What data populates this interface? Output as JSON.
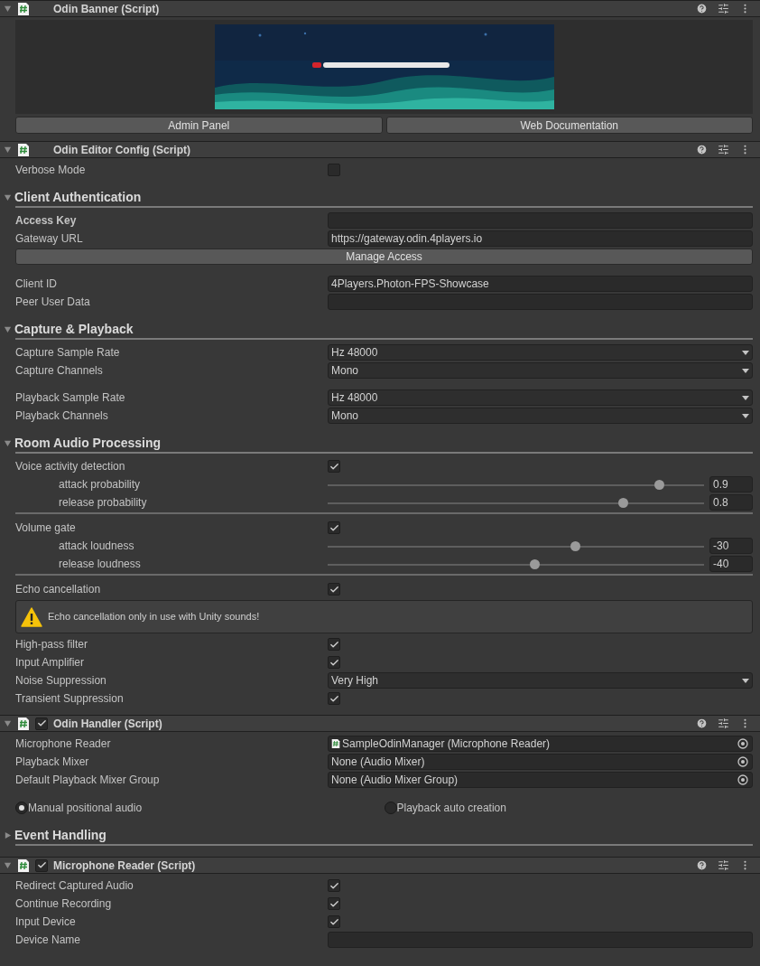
{
  "components": [
    {
      "title": "Odin Banner (Script)",
      "expanded": true,
      "rows": [
        {
          "kind": "banner"
        },
        {
          "kind": "buttons",
          "labels": [
            "Admin Panel",
            "Web Documentation"
          ]
        }
      ]
    },
    {
      "title": "Odin Editor Config (Script)",
      "expanded": true,
      "rows": [
        {
          "kind": "checkbox",
          "label": "Verbose Mode",
          "checked": false
        },
        {
          "kind": "section",
          "title": "Client Authentication",
          "expanded": true,
          "divided": false,
          "groups": [
            [
              {
                "kind": "text",
                "label": "Access Key",
                "bold": true
              },
              {
                "kind": "text",
                "label": "Gateway URL",
                "value": "https://gateway.odin.4players.io"
              },
              {
                "kind": "button",
                "label": "Manage Access"
              }
            ],
            [
              {
                "kind": "text",
                "label": "Client ID",
                "value": "4Players.Photon-FPS-Showcase"
              },
              {
                "kind": "text",
                "label": "Peer User Data"
              }
            ]
          ]
        },
        {
          "kind": "section",
          "title": "Capture & Playback",
          "expanded": true,
          "divided": false,
          "groups": [
            [
              {
                "kind": "dropdown",
                "label": "Capture Sample Rate",
                "value": "Hz 48000"
              },
              {
                "kind": "dropdown",
                "label": "Capture Channels",
                "value": "Mono"
              }
            ],
            [
              {
                "kind": "dropdown",
                "label": "Playback Sample Rate",
                "value": "Hz 48000"
              },
              {
                "kind": "dropdown",
                "label": "Playback Channels",
                "value": "Mono"
              }
            ]
          ]
        },
        {
          "kind": "section",
          "title": "Room Audio Processing",
          "expanded": true,
          "divided": true,
          "groups": [
            [
              {
                "kind": "checkbox",
                "label": "Voice activity detection",
                "checked": true
              },
              {
                "kind": "slider",
                "label": "attack probability",
                "level": 0.89,
                "reading": "0.9"
              },
              {
                "kind": "slider",
                "label": "release probability",
                "level": 0.79,
                "reading": "0.8"
              }
            ],
            [
              {
                "kind": "checkbox",
                "label": "Volume gate",
                "checked": true
              },
              {
                "kind": "slider",
                "label": "attack loudness",
                "level": 0.66,
                "reading": "-30"
              },
              {
                "kind": "slider",
                "label": "release loudness",
                "level": 0.55,
                "reading": "-40"
              }
            ],
            [
              {
                "kind": "checkbox",
                "label": "Echo cancellation",
                "checked": true
              },
              {
                "kind": "warning",
                "text": "Echo cancellation only in use with Unity sounds!"
              },
              {
                "kind": "checkbox",
                "label": "High-pass filter",
                "checked": true
              },
              {
                "kind": "checkbox",
                "label": "Input Amplifier",
                "checked": true
              },
              {
                "kind": "dropdown",
                "label": "Noise Suppression",
                "value": "Very High"
              },
              {
                "kind": "checkbox",
                "label": "Transient Suppression",
                "checked": true
              }
            ]
          ]
        }
      ]
    },
    {
      "title": "Odin Handler (Script)",
      "expanded": true,
      "enabled": true,
      "rows": [
        {
          "kind": "object",
          "label": "Microphone Reader",
          "value": "SampleOdinManager (Microphone Reader)",
          "script_icon": true
        },
        {
          "kind": "object",
          "label": "Playback Mixer",
          "value": "None (Audio Mixer)",
          "script_icon": false
        },
        {
          "kind": "object",
          "label": "Default Playback Mixer Group",
          "value": "None (Audio Mixer Group)",
          "script_icon": false
        },
        {
          "kind": "radios",
          "options": [
            {
              "label": "Manual positional audio",
              "selected": true
            },
            {
              "label": "Playback auto creation",
              "selected": false
            }
          ]
        },
        {
          "kind": "section",
          "title": "Event Handling",
          "expanded": false
        }
      ]
    },
    {
      "title": "Microphone Reader (Script)",
      "expanded": true,
      "enabled": true,
      "rows": [
        {
          "kind": "checkbox",
          "label": "Redirect Captured Audio",
          "checked": true
        },
        {
          "kind": "checkbox",
          "label": "Continue Recording",
          "checked": true
        },
        {
          "kind": "checkbox",
          "label": "Input Device",
          "checked": true
        },
        {
          "kind": "text",
          "label": "Device Name"
        }
      ]
    }
  ]
}
